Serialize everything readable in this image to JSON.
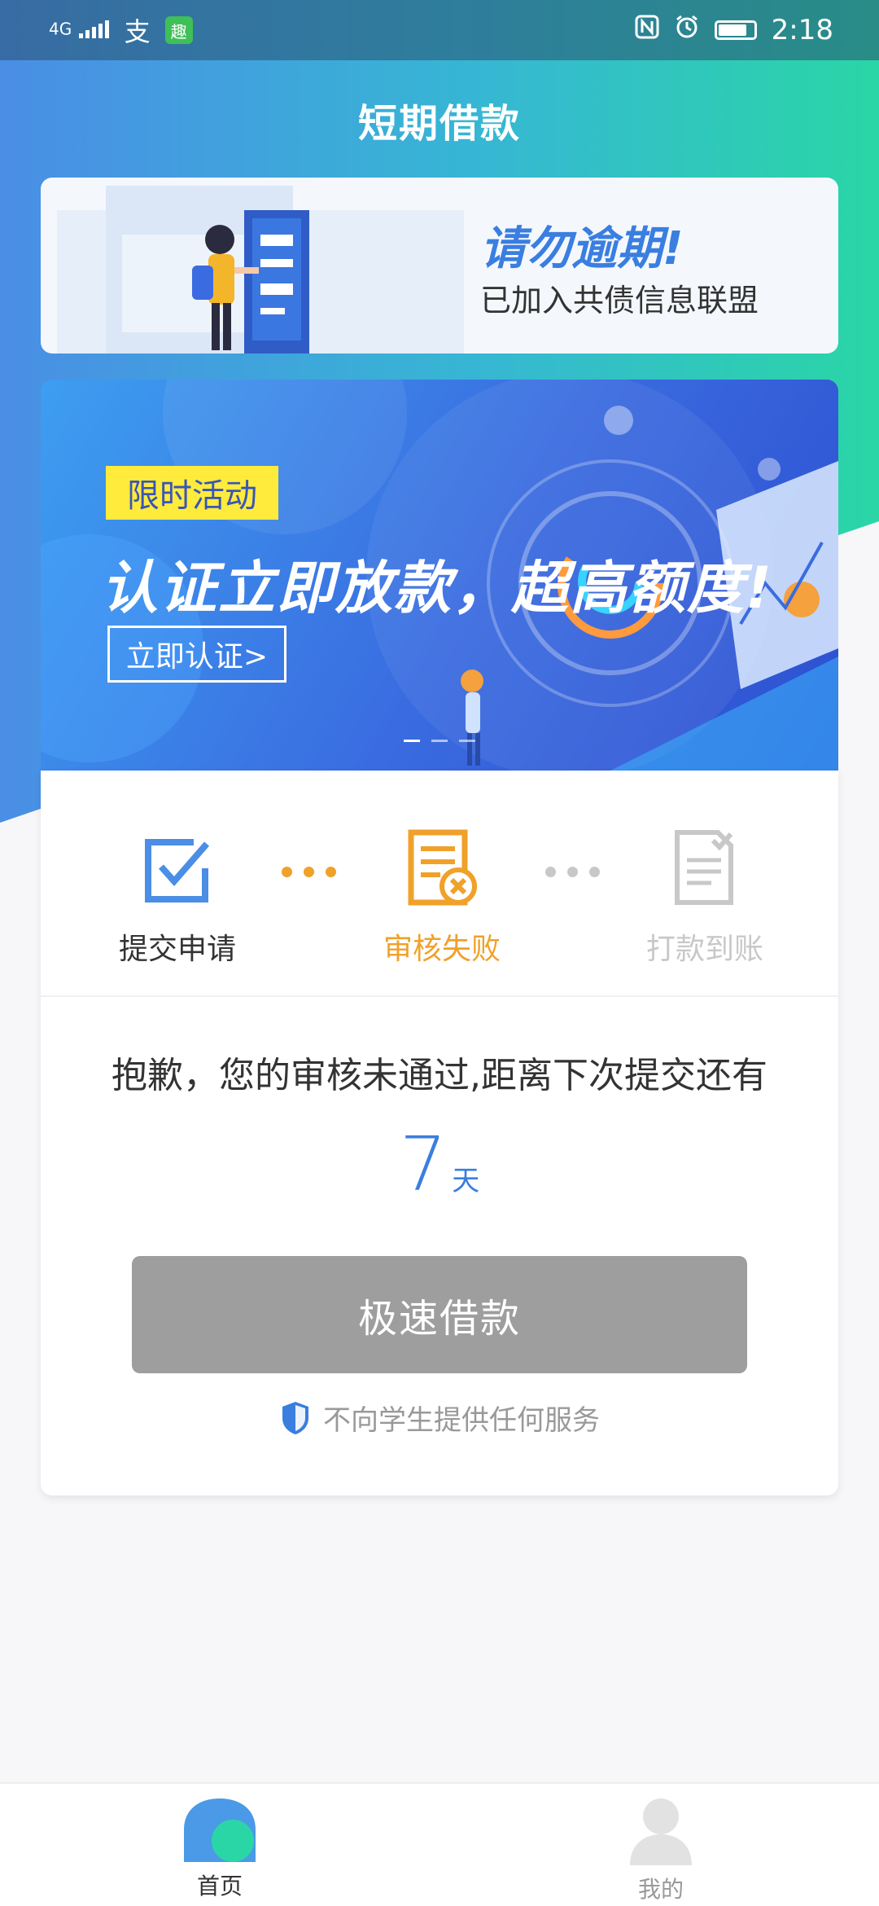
{
  "status_bar": {
    "signal_text": "4G",
    "alipay_glyph": "支",
    "app_glyph": "趣",
    "time": "2:18",
    "icons": [
      "signal-icon",
      "alipay-icon",
      "app-icon",
      "nfc-icon",
      "alarm-icon",
      "battery-icon"
    ]
  },
  "header": {
    "title": "短期借款"
  },
  "notice_banner": {
    "headline": "请勿逾期!",
    "subtext": "已加入共债信息联盟"
  },
  "promo_banner": {
    "tag": "限时活动",
    "title": "认证立即放款，超高额度!",
    "button": "立即认证>",
    "slides": 3,
    "active_slide": 1
  },
  "progress_steps": [
    {
      "label": "提交申请",
      "state": "done",
      "color": "#4a8ee6",
      "icon": "checkbox-icon"
    },
    {
      "label": "审核失败",
      "state": "failed",
      "color": "#f0a12a",
      "icon": "document-reject-icon"
    },
    {
      "label": "打款到账",
      "state": "pending",
      "color": "#c8c8c8",
      "icon": "document-check-icon"
    }
  ],
  "review": {
    "message": "抱歉，您的审核未通过,距离下次提交还有",
    "days_value": "7",
    "days_unit": "天"
  },
  "loan_button": {
    "label": "极速借款"
  },
  "student_notice": {
    "text": "不向学生提供任何服务",
    "icon": "shield-icon"
  },
  "tabs": [
    {
      "label": "首页",
      "active": true,
      "icon": "home-icon"
    },
    {
      "label": "我的",
      "active": false,
      "icon": "profile-icon"
    }
  ],
  "colors": {
    "accent": "#3a7ee0",
    "warning": "#f0a12a",
    "disabled": "#9e9e9e"
  }
}
